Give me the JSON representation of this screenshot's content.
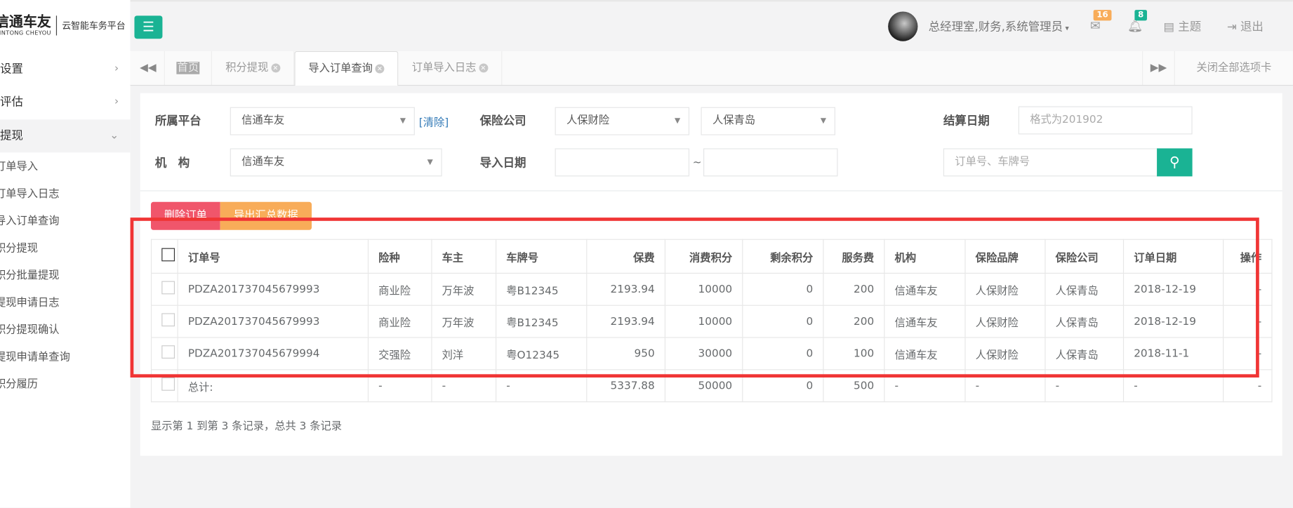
{
  "sidebar": {
    "logo_main": "信通车友",
    "logo_sub": "XINTONG CHEYOU",
    "logo_tag": "云智能车务平台",
    "menu": [
      {
        "label": "设置"
      },
      {
        "label": "评估"
      },
      {
        "label": "提现"
      }
    ],
    "sub_items": [
      "订单导入",
      "订单导入日志",
      "导入订单查询",
      "积分提现",
      "积分批量提现",
      "提现申请日志",
      "积分提现确认",
      "提现申请单查询",
      "积分履历"
    ]
  },
  "topbar": {
    "user": "总经理室,财务,系统管理员",
    "mail_count": "16",
    "bell_count": "8",
    "theme": "主题",
    "logout": "退出"
  },
  "tabs": {
    "items": [
      "首页",
      "积分提现",
      "导入订单查询",
      "订单导入日志"
    ],
    "close_all": "关闭全部选项卡"
  },
  "filters": {
    "platform_label": "所属平台",
    "platform_value": "信通车友",
    "clear": "[清除]",
    "insurer_label": "保险公司",
    "insurer_value": "人保财险",
    "branch_value": "人保青岛",
    "settle_label": "结算日期",
    "settle_placeholder": "格式为201902",
    "org_label": "机　构",
    "org_value": "信通车友",
    "import_label": "导入日期",
    "tilde": "~",
    "search_placeholder": "订单号、车牌号"
  },
  "actions": {
    "delete": "删除订单",
    "export": "导出汇总数据"
  },
  "table": {
    "headers": [
      "订单号",
      "险种",
      "车主",
      "车牌号",
      "保费",
      "消费积分",
      "剩余积分",
      "服务费",
      "机构",
      "保险品牌",
      "保险公司",
      "订单日期",
      "操作"
    ],
    "rows": [
      [
        "PDZA201737045679993",
        "商业险",
        "万年波",
        "粤B12345",
        "2193.94",
        "10000",
        "0",
        "200",
        "信通车友",
        "人保财险",
        "人保青岛",
        "2018-12-19",
        "-"
      ],
      [
        "PDZA201737045679993",
        "商业险",
        "万年波",
        "粤B12345",
        "2193.94",
        "10000",
        "0",
        "200",
        "信通车友",
        "人保财险",
        "人保青岛",
        "2018-12-19",
        "-"
      ],
      [
        "PDZA201737045679994",
        "交强险",
        "刘洋",
        "粤O12345",
        "950",
        "30000",
        "0",
        "100",
        "信通车友",
        "人保财险",
        "人保青岛",
        "2018-11-1",
        "-"
      ]
    ],
    "total": [
      "总计:",
      "-",
      "-",
      "-",
      "5337.88",
      "50000",
      "0",
      "500",
      "-",
      "-",
      "-",
      "-",
      "-"
    ]
  },
  "footer": "显示第 1 到第 3 条记录，总共 3 条记录",
  "colors": {
    "accent": "#1ab394",
    "danger": "#ed5565",
    "warning": "#f8ac59",
    "highlight": "#f03535"
  }
}
